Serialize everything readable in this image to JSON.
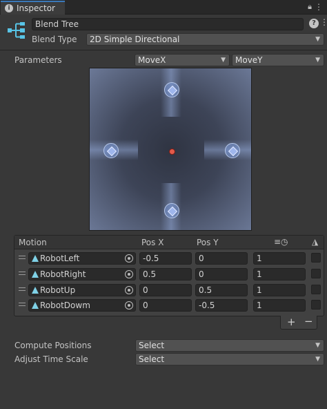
{
  "tab": {
    "label": "Inspector",
    "icon": "info-icon"
  },
  "header": {
    "name_value": "Blend Tree",
    "icon": "blend-tree-icon"
  },
  "blend_type": {
    "label": "Blend Type",
    "value": "2D Simple Directional"
  },
  "parameters": {
    "label": "Parameters",
    "x_param": "MoveX",
    "y_param": "MoveY"
  },
  "motion_list": {
    "headers": {
      "motion": "Motion",
      "pos_x": "Pos X",
      "pos_y": "Pos Y"
    },
    "rows": [
      {
        "motion": "RobotLeft",
        "pos_x": "-0.5",
        "pos_y": "0",
        "speed": "1"
      },
      {
        "motion": "RobotRight",
        "pos_x": "0.5",
        "pos_y": "0",
        "speed": "1"
      },
      {
        "motion": "RobotUp",
        "pos_x": "0",
        "pos_y": "0.5",
        "speed": "1"
      },
      {
        "motion": "RobotDowm",
        "pos_x": "0",
        "pos_y": "-0.5",
        "speed": "1"
      }
    ],
    "add_label": "+",
    "remove_label": "−"
  },
  "compute_positions": {
    "label": "Compute Positions",
    "value": "Select"
  },
  "adjust_time_scale": {
    "label": "Adjust Time Scale",
    "value": "Select"
  },
  "colors": {
    "tab_accent": "#3a79bb",
    "center_marker": "#e25a4a",
    "node": "#9fb6ec"
  }
}
